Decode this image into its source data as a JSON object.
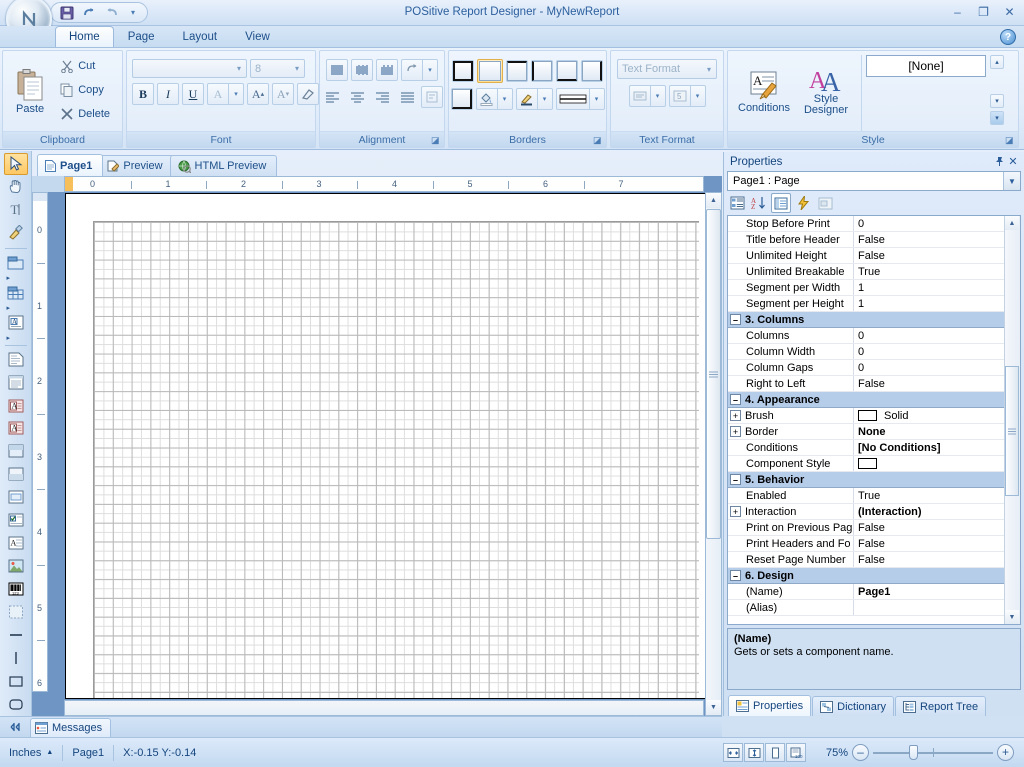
{
  "window": {
    "title": "POSitive Report Designer - MyNewReport",
    "minimize": "–",
    "maximize": "❐",
    "close": "✕",
    "help": "?",
    "orb_icon": "app-orb-icon",
    "qat": [
      {
        "name": "save",
        "glyph": "💾"
      },
      {
        "name": "undo",
        "glyph": "↶"
      },
      {
        "name": "redo",
        "glyph": "↷"
      },
      {
        "name": "customize",
        "glyph": "▾"
      }
    ]
  },
  "ribbon": {
    "tabs": [
      {
        "label": "Home",
        "active": true
      },
      {
        "label": "Page",
        "active": false
      },
      {
        "label": "Layout",
        "active": false
      },
      {
        "label": "View",
        "active": false
      }
    ],
    "groups": {
      "clipboard": {
        "label": "Clipboard",
        "paste": "Paste",
        "cut": "Cut",
        "copy": "Copy",
        "delete": "Delete"
      },
      "font": {
        "label": "Font",
        "family_value": "",
        "size_value": "8",
        "bold": "B",
        "italic": "I",
        "underline": "U",
        "color": "A",
        "grow": "A",
        "shrink": "A",
        "clear": "clear-format"
      },
      "alignment": {
        "label": "Alignment"
      },
      "borders": {
        "label": "Borders"
      },
      "textformat": {
        "label": "Text Format",
        "combo_value": "Text Format"
      },
      "style": {
        "label": "Style",
        "conditions": "Conditions",
        "style_designer_line1": "Style",
        "style_designer_line2": "Designer",
        "style_value": "[None]"
      }
    }
  },
  "toolbox": {
    "tools": [
      {
        "name": "select-pointer-tool",
        "glyph": "⬉",
        "active": true
      },
      {
        "name": "hand-pan-tool",
        "glyph": "✋",
        "active": false
      },
      {
        "name": "text-edit-tool",
        "glyph": "T",
        "active": false
      },
      {
        "name": "format-painter-tool",
        "glyph": "🖌",
        "active": false
      },
      {
        "name": "band-tool",
        "glyph": "▤",
        "active": false,
        "dropdown": true
      },
      {
        "name": "cross-band-tool",
        "glyph": "▦",
        "active": false,
        "dropdown": true
      },
      {
        "name": "data-band-tool",
        "glyph": "▣",
        "active": false,
        "dropdown": true
      },
      {
        "name": "text-component-tool",
        "glyph": "▤",
        "active": false
      },
      {
        "name": "rich-text-tool",
        "glyph": "▥",
        "active": false
      },
      {
        "name": "system-text-tool",
        "glyph": "A",
        "active": false
      },
      {
        "name": "text-in-cells-tool",
        "glyph": "A",
        "active": false
      },
      {
        "name": "panel-tool",
        "glyph": "▢",
        "active": false
      },
      {
        "name": "clone-panel-tool",
        "glyph": "▢",
        "active": false
      },
      {
        "name": "subreport-tool",
        "glyph": "▣",
        "active": false
      },
      {
        "name": "checkbox-tool",
        "glyph": "☑",
        "active": false
      },
      {
        "name": "zip-code-tool",
        "glyph": "A",
        "active": false
      },
      {
        "name": "image-tool",
        "glyph": "🖼",
        "active": false
      },
      {
        "name": "barcode-tool",
        "glyph": "▥",
        "active": false
      },
      {
        "name": "shape-tool",
        "glyph": "▢",
        "active": false
      },
      {
        "name": "horizontal-line-tool",
        "glyph": "―",
        "active": false
      },
      {
        "name": "vertical-line-tool",
        "glyph": "|",
        "active": false
      },
      {
        "name": "rectangle-tool",
        "glyph": "▭",
        "active": false
      },
      {
        "name": "rounded-rectangle-tool",
        "glyph": "▭",
        "active": false
      }
    ]
  },
  "document": {
    "tabs": [
      {
        "label": "Page1",
        "icon": "page-icon",
        "active": true
      },
      {
        "label": "Preview",
        "icon": "preview-icon",
        "active": false
      },
      {
        "label": "HTML Preview",
        "icon": "globe-icon",
        "active": false
      }
    ],
    "ruler_h": [
      "0",
      "1",
      "2",
      "3",
      "4",
      "5",
      "6",
      "7"
    ],
    "ruler_v": [
      "0",
      "1",
      "2",
      "3",
      "4",
      "5",
      "6"
    ]
  },
  "properties": {
    "title": "Properties",
    "pin": "📌",
    "close": "✕",
    "object_selector": "Page1 : Page",
    "toolbar": [
      {
        "name": "categorized-button",
        "glyph": "▤",
        "on": false
      },
      {
        "name": "alphabetical-sort-button",
        "glyph": "A↓",
        "on": false
      },
      {
        "name": "properties-view-button",
        "glyph": "▤",
        "on": true
      },
      {
        "name": "events-view-button",
        "glyph": "⚡",
        "on": false
      },
      {
        "name": "property-pages-button",
        "glyph": "▭",
        "on": false
      }
    ],
    "rows": [
      {
        "type": "prop",
        "name": "Stop Before Print",
        "value": "0"
      },
      {
        "type": "prop",
        "name": "Title before Header",
        "value": "False"
      },
      {
        "type": "prop",
        "name": "Unlimited Height",
        "value": "False"
      },
      {
        "type": "prop",
        "name": "Unlimited Breakable",
        "value": "True"
      },
      {
        "type": "prop",
        "name": "Segment per Width",
        "value": "1"
      },
      {
        "type": "prop",
        "name": "Segment per Height",
        "value": "1"
      },
      {
        "type": "cat",
        "name": "3. Columns",
        "expander": "–"
      },
      {
        "type": "prop",
        "name": "Columns",
        "value": "0"
      },
      {
        "type": "prop",
        "name": "Column Width",
        "value": "0"
      },
      {
        "type": "prop",
        "name": "Column Gaps",
        "value": "0"
      },
      {
        "type": "prop",
        "name": "Right to Left",
        "value": "False"
      },
      {
        "type": "cat",
        "name": "4. Appearance",
        "expander": "–"
      },
      {
        "type": "prop",
        "name": "Brush",
        "value": "Solid",
        "expander": "+",
        "swatch": "#ffffff"
      },
      {
        "type": "prop",
        "name": "Border",
        "value": "None",
        "expander": "+",
        "bold": true
      },
      {
        "type": "prop",
        "name": "Conditions",
        "value": "[No Conditions]",
        "bold": true
      },
      {
        "type": "prop",
        "name": "Component Style",
        "value": "",
        "swatch": "#ffffff"
      },
      {
        "type": "cat",
        "name": "5. Behavior",
        "expander": "–"
      },
      {
        "type": "prop",
        "name": "Enabled",
        "value": "True"
      },
      {
        "type": "prop",
        "name": "Interaction",
        "value": "(Interaction)",
        "expander": "+",
        "bold": true
      },
      {
        "type": "prop",
        "name": "Print on Previous Pag",
        "value": "False"
      },
      {
        "type": "prop",
        "name": "Print Headers and Fo",
        "value": "False"
      },
      {
        "type": "prop",
        "name": "Reset Page Number",
        "value": "False"
      },
      {
        "type": "cat",
        "name": "6. Design",
        "expander": "–"
      },
      {
        "type": "prop",
        "name": "(Name)",
        "value": "Page1",
        "bold": true
      },
      {
        "type": "prop",
        "name": "(Alias)",
        "value": ""
      }
    ],
    "description": {
      "title": "(Name)",
      "text": "Gets or sets a component name."
    },
    "panel_tabs": [
      {
        "label": "Properties",
        "icon": "properties-icon",
        "active": true
      },
      {
        "label": "Dictionary",
        "icon": "dictionary-icon",
        "active": false
      },
      {
        "label": "Report Tree",
        "icon": "tree-icon",
        "active": false
      }
    ]
  },
  "messages": {
    "tab_label": "Messages",
    "tab_icon": "messages-icon",
    "pin_icon": "pin-icon"
  },
  "status": {
    "units": "Inches",
    "units_arrow": "▲",
    "page": "Page1",
    "coords": "X:-0.15 Y:-0.14",
    "zoom_label": "75%",
    "zoom_out": "–",
    "zoom_in": "+",
    "view_buttons": [
      {
        "name": "fit-width-button",
        "glyph": "⬌"
      },
      {
        "name": "fit-height-button",
        "glyph": "⬍"
      },
      {
        "name": "one-page-button",
        "glyph": "▯"
      },
      {
        "name": "zoom-100-button",
        "glyph": "▤"
      }
    ]
  },
  "colors": {
    "accent": "#2b5f9e",
    "category_bg": "#b6cdea",
    "highlight": "#ffc862"
  }
}
